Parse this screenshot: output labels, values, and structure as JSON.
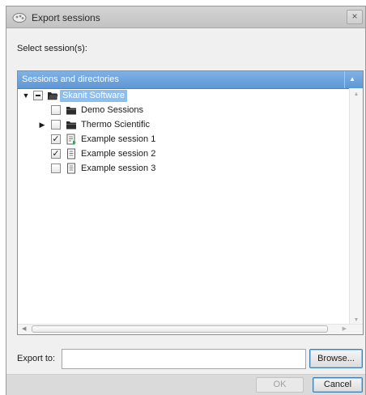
{
  "window": {
    "title": "Export sessions",
    "close_label": "×"
  },
  "select_label": "Select session(s):",
  "panel": {
    "header": "Sessions and directories",
    "sort_glyph": "▲",
    "tree": [
      {
        "label": "Skanit Software",
        "level": 0,
        "expander": "▼",
        "checkbox": "indeterminate",
        "icon": "folder-open-icon",
        "selected": true
      },
      {
        "label": "Demo Sessions",
        "level": 1,
        "expander": "",
        "checkbox": "unchecked",
        "icon": "folder-icon",
        "selected": false
      },
      {
        "label": "Thermo Scientific",
        "level": 1,
        "expander": "▶",
        "checkbox": "unchecked",
        "icon": "folder-icon",
        "selected": false
      },
      {
        "label": "Example session 1",
        "level": 1,
        "expander": "",
        "checkbox": "checked",
        "icon": "session-running-icon",
        "selected": false
      },
      {
        "label": "Example session 2",
        "level": 1,
        "expander": "",
        "checkbox": "checked",
        "icon": "session-icon",
        "selected": false
      },
      {
        "label": "Example session 3",
        "level": 1,
        "expander": "",
        "checkbox": "unchecked",
        "icon": "session-icon",
        "selected": false
      }
    ]
  },
  "export": {
    "label": "Export to:",
    "value": "",
    "browse_label": "Browse..."
  },
  "footer": {
    "ok_label": "OK",
    "cancel_label": "Cancel"
  },
  "colors": {
    "header_blue": "#6fa5df",
    "selection": "#8cbef0",
    "focus_border": "#3c7fb1"
  }
}
